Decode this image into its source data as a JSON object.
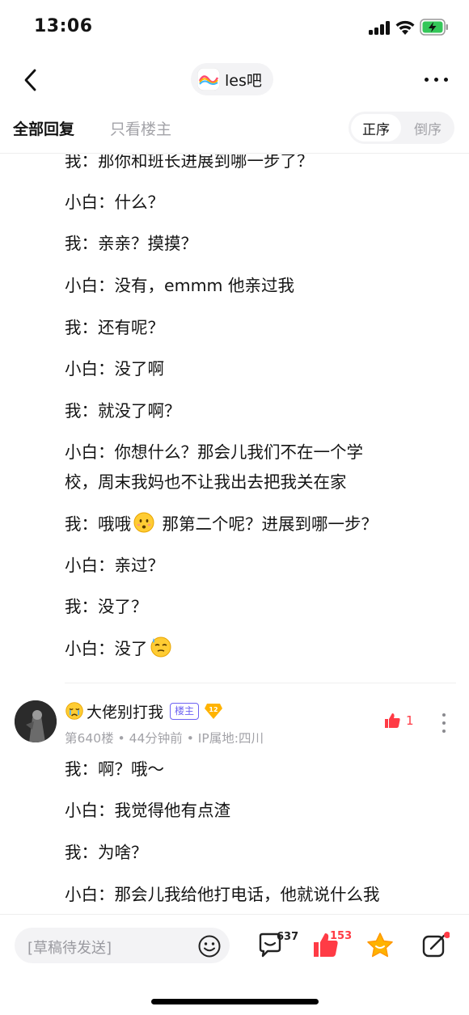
{
  "status_bar": {
    "time": "13:06"
  },
  "header": {
    "forum_name": "les吧"
  },
  "filter": {
    "all_replies": "全部回复",
    "host_only": "只看楼主",
    "order_asc": "正序",
    "order_desc": "倒序"
  },
  "lines": [
    "我：那你和班长进展到哪一步了？",
    "小白：什么？",
    "我：亲亲？摸摸？",
    "小白：没有，emmm 他亲过我",
    "我：还有呢？",
    "小白：没了啊",
    "我：就没了啊？",
    "小白：你想什么？那会儿我们不在一个学",
    "校，周末我妈也不让我出去把我关在家",
    "我：哦哦",
    "那第二个呢？进展到哪一步？",
    "小白：亲过？",
    "我：没了？",
    "小白：没了"
  ],
  "post": {
    "user_name": "大佬别打我",
    "host_badge": "楼主",
    "level": "12",
    "meta": "第640楼 • 44分钟前 • IP属地:四川",
    "like_count": "1",
    "lines": [
      "我：啊？哦～",
      "小白：我觉得他有点渣",
      "我：为啥？",
      "小白：那会儿我给他打电话，他就说什么我"
    ]
  },
  "bottom_bar": {
    "draft_placeholder": "[草稿待发送]",
    "comment_count": "637",
    "like_count": "153"
  },
  "colors": {
    "accent_red": "#ff3b45",
    "host_badge": "#6d62f2",
    "star": "#ffb300"
  },
  "icons": [
    "back-icon",
    "more-icon",
    "smile-icon",
    "comment-icon",
    "thumbs-up-icon",
    "star-icon",
    "share-icon"
  ]
}
